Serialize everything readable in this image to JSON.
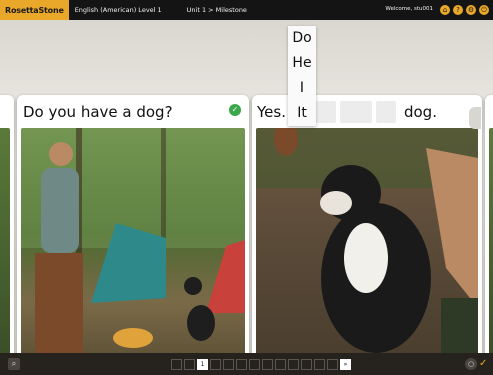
{
  "topbar": {
    "logo": "RosettaStone",
    "course": "English (American) Level 1",
    "unit": "Unit 1 > Milestone",
    "welcome": "Welcome, stu001",
    "icons": [
      "home-icon",
      "help-icon",
      "settings-icon",
      "exit-icon"
    ]
  },
  "panel_left": {
    "text": "Do you have a dog?",
    "check_icon": "checkmark-icon"
  },
  "panel_right": {
    "prefix": "Yes.",
    "suffix": "dog."
  },
  "dropdown": {
    "options": [
      "Do",
      "He",
      "I",
      "It"
    ]
  },
  "bottombar": {
    "current_page": "1",
    "next_label": "»",
    "page_count": 14
  },
  "colors": {
    "accent": "#e9a82a",
    "topbar": "#141414",
    "bottombar": "#26231f",
    "check": "#3aa84a"
  }
}
